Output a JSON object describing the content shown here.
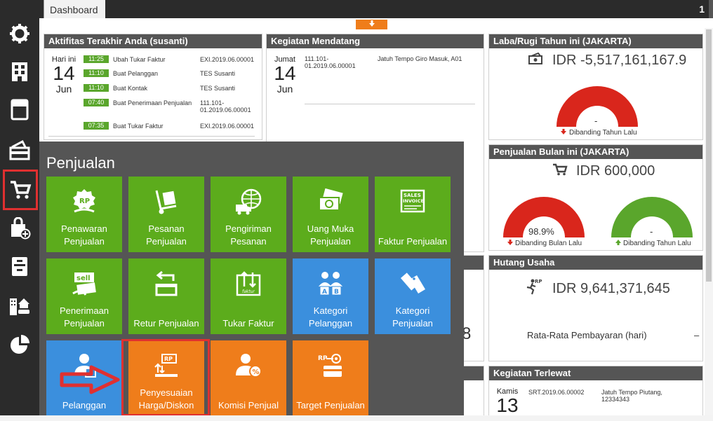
{
  "topbar": {
    "tab_label": "Dashboard",
    "right_num": "1"
  },
  "toggle": {
    "arrow": "🡓"
  },
  "activity": {
    "title": "Aktifitas Terakhir Anda (susanti)",
    "day": "Hari ini",
    "date_num": "14",
    "date_mon": "Jun",
    "rows": [
      {
        "time": "11:25",
        "action": "Ubah Tukar Faktur",
        "ref": "EXI.2019.06.00001"
      },
      {
        "time": "11:10",
        "action": "Buat Pelanggan",
        "ref": "TES Susanti"
      },
      {
        "time": "11:10",
        "action": "Buat Kontak",
        "ref": "TES Susanti"
      },
      {
        "time": "07:40",
        "action": "Buat Penerimaan Penjualan",
        "ref": "111.101-01.2019.06.00001"
      },
      {
        "time": "07:35",
        "action": "Buat Tukar Faktur",
        "ref": "EXI.2019.06.00001"
      }
    ]
  },
  "upcoming": {
    "title": "Kegiatan Mendatang",
    "day": "Jumat",
    "date_num": "14",
    "date_mon": "Jun",
    "ref": "111.101-01.2019.06.00001",
    "desc": "Jatuh Tempo Giro Masuk, A01"
  },
  "profit": {
    "title": "Laba/Rugi Tahun ini (JAKARTA)",
    "value": "IDR -5,517,161,167.9",
    "gauge_text": "-",
    "note": "Dibanding Tahun Lalu"
  },
  "sales": {
    "title": "Penjualan Bulan ini (JAKARTA)",
    "value": "IDR 600,000",
    "gauge1_text": "98.9%",
    "gauge1_note": "Dibanding Bulan Lalu",
    "gauge2_text": "-",
    "gauge2_note": "Dibanding Tahun Lalu"
  },
  "payable": {
    "title": "Hutang Usaha",
    "value": "IDR 9,641,371,645",
    "avg_label": "Rata-Rata Pembayaran (hari)",
    "avg_value": "–"
  },
  "recent": {
    "title": "Kegiatan Terlewat",
    "day": "Kamis",
    "date_num": "13",
    "ref": "SRT.2019.06.00002",
    "desc": "Jatuh Tempo Piutang, 12334343"
  },
  "hidden_digit": "8",
  "menu": {
    "title": "Penjualan",
    "tiles": [
      {
        "label": "Penawaran Penjualan",
        "icon": "quotation-icon"
      },
      {
        "label": "Pesanan Penjualan",
        "icon": "hand-truck-icon"
      },
      {
        "label": "Pengiriman Pesanan",
        "icon": "delivery-globe-icon"
      },
      {
        "label": "Uang Muka Penjualan",
        "icon": "cash-icon"
      },
      {
        "label": "Faktur Penjualan",
        "icon": "sales-invoice-icon"
      },
      {
        "label": "Penerimaan Penjualan",
        "icon": "sell-receipt-icon"
      },
      {
        "label": "Retur Penjualan",
        "icon": "return-icon"
      },
      {
        "label": "Tukar Faktur",
        "icon": "invoice-exchange-icon"
      },
      {
        "label": "Kategori Pelanggan",
        "icon": "customer-category-icon"
      },
      {
        "label": "Kategori Penjualan",
        "icon": "tags-icon"
      },
      {
        "label": "Pelanggan",
        "icon": "customer-icon"
      },
      {
        "label": "Penyesuaian Harga/Diskon",
        "icon": "price-adjust-icon"
      },
      {
        "label": "Komisi Penjual",
        "icon": "commission-icon"
      },
      {
        "label": "Target Penjualan",
        "icon": "sales-target-icon"
      }
    ]
  },
  "colors": {
    "green": "#5cac1c",
    "blue": "#3b8fdd",
    "orange": "#ef7d1b",
    "highlight": "#e03030",
    "gauge_red": "#d9261c",
    "gauge_green": "#5aa62c"
  }
}
